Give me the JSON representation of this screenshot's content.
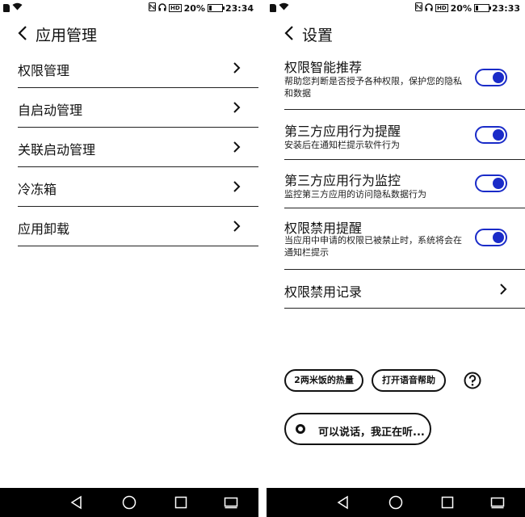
{
  "left": {
    "status": {
      "battery": "20%",
      "time": "23:34",
      "battery_level": 0.2
    },
    "header": {
      "title": "应用管理"
    },
    "items": [
      {
        "label": "权限管理"
      },
      {
        "label": "自启动管理"
      },
      {
        "label": "关联启动管理"
      },
      {
        "label": "冷冻箱"
      },
      {
        "label": "应用卸载"
      }
    ]
  },
  "right": {
    "status": {
      "battery": "20%",
      "time": "23:33",
      "battery_level": 0.2
    },
    "header": {
      "title": "设置"
    },
    "settings": [
      {
        "title": "权限智能推荐",
        "desc": "帮助您判断是否授予各种权限，保护您的隐私和数据",
        "enabled": true
      },
      {
        "title": "第三方应用行为提醒",
        "desc": "安装后在通知栏提示软件行为",
        "enabled": true
      },
      {
        "title": "第三方应用行为监控",
        "desc": "监控第三方应用的访问隐私数据行为",
        "enabled": true
      },
      {
        "title": "权限禁用提醒",
        "desc": "当应用中申请的权限已被禁止时，系统将会在通知栏提示",
        "enabled": true
      },
      {
        "title": "权限禁用记录"
      }
    ],
    "voice": {
      "suggestion1": "2两米饭的热量",
      "suggestion2": "打开语音帮助",
      "listening": "可以说话，我正在听..."
    }
  },
  "status_icons": {
    "hd_label": "HD"
  },
  "colors": {
    "toggle_accent": "#1a2bc8",
    "navbar": "#000000"
  }
}
